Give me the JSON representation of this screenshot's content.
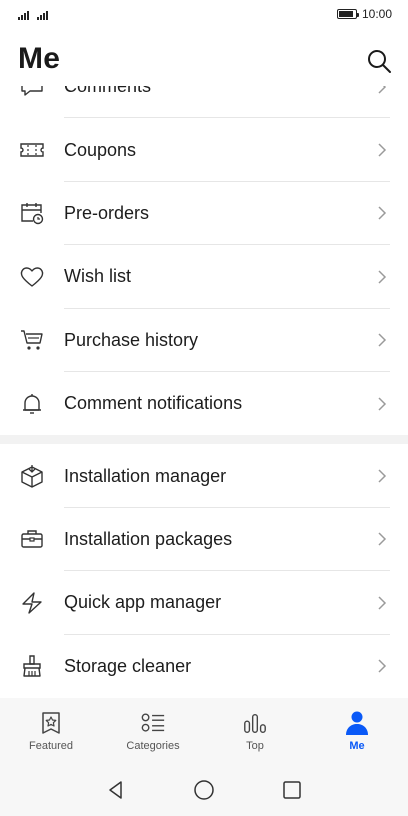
{
  "status_bar": {
    "time": "10:00",
    "battery_level": 0.9
  },
  "header": {
    "title": "Me"
  },
  "list": {
    "sections": [
      {
        "items": [
          {
            "label": "Comments",
            "icon": "comment-icon"
          },
          {
            "label": "Coupons",
            "icon": "coupon-icon"
          },
          {
            "label": "Pre-orders",
            "icon": "calendar-clock-icon"
          },
          {
            "label": "Wish list",
            "icon": "heart-icon"
          },
          {
            "label": "Purchase history",
            "icon": "cart-icon"
          },
          {
            "label": "Comment notifications",
            "icon": "bell-icon"
          }
        ]
      },
      {
        "items": [
          {
            "label": "Installation manager",
            "icon": "box-download-icon"
          },
          {
            "label": "Installation packages",
            "icon": "briefcase-icon"
          },
          {
            "label": "Quick app manager",
            "icon": "lightning-icon"
          },
          {
            "label": "Storage cleaner",
            "icon": "brush-icon"
          }
        ]
      }
    ]
  },
  "bottom_nav": {
    "items": [
      {
        "label": "Featured",
        "icon": "star-bookmark-icon",
        "active": false
      },
      {
        "label": "Categories",
        "icon": "categories-icon",
        "active": false
      },
      {
        "label": "Top",
        "icon": "bar-chart-icon",
        "active": false
      },
      {
        "label": "Me",
        "icon": "person-icon",
        "active": true
      }
    ]
  },
  "colors": {
    "accent": "#0a59f7",
    "text": "#1d1d1d",
    "icon": "#333333",
    "chevron": "#9a9a9a"
  }
}
